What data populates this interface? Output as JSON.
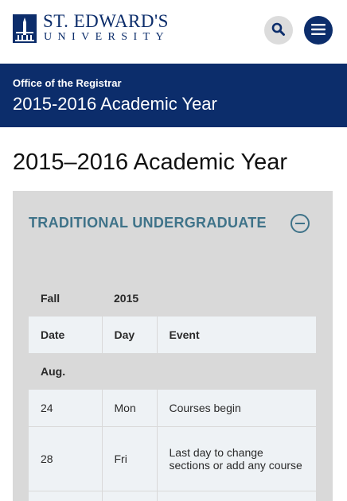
{
  "header": {
    "logo_name": "ST. EDWARD'S",
    "logo_sub": "UNIVERSITY",
    "search_icon": "search-icon",
    "menu_icon": "hamburger-menu-icon"
  },
  "banner": {
    "kicker": "Office of the Registrar",
    "title": "2015-2016 Academic Year"
  },
  "page": {
    "title": "2015–2016 Academic Year"
  },
  "accordion": {
    "heading": "TRADITIONAL UNDERGRADUATE",
    "toggle_icon": "collapse-minus-icon"
  },
  "calendar": {
    "term": "Fall",
    "year": "2015",
    "columns": [
      "Date",
      "Day",
      "Event"
    ],
    "month": "Aug.",
    "rows": [
      {
        "date": "24",
        "day": "Mon",
        "event": "Courses begin"
      },
      {
        "date": "28",
        "day": "Fri",
        "event": "Last day to change sections or add any course"
      },
      {
        "date": "",
        "day": "",
        "event": ""
      }
    ]
  },
  "colors": {
    "brand_navy": "#0c2d6b",
    "heading_teal": "#3f7389",
    "panel_gray": "#d9d9d9",
    "cell_light": "#eef2f5"
  }
}
